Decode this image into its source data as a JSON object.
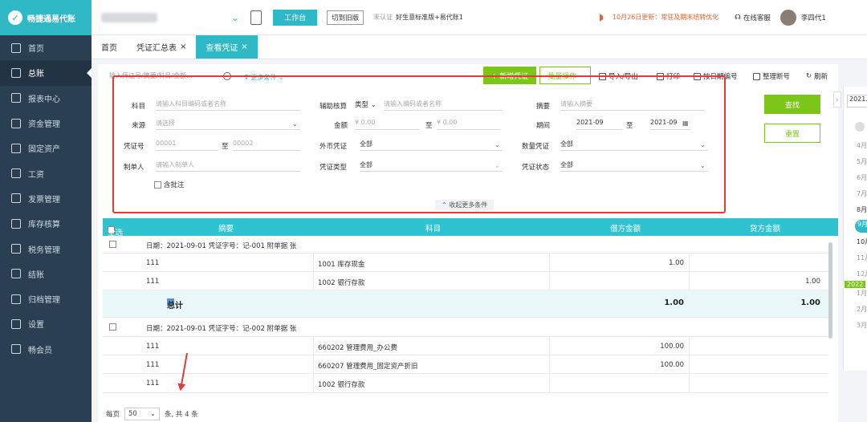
{
  "app": {
    "name": "畅捷通易代账",
    "plan": "好生意标准版+易代账1",
    "cert": "未认证"
  },
  "topbar": {
    "workbench": "工作台",
    "old_version": "切到旧版",
    "notice": "10月26日更新：常驻及期末结转优化",
    "service": "在线客服",
    "user": "李四代1"
  },
  "sidebar": {
    "items": [
      {
        "label": "首页"
      },
      {
        "label": "总账"
      },
      {
        "label": "报表中心"
      },
      {
        "label": "资金管理"
      },
      {
        "label": "固定资产"
      },
      {
        "label": "工资"
      },
      {
        "label": "发票管理"
      },
      {
        "label": "库存核算"
      },
      {
        "label": "税务管理"
      },
      {
        "label": "结账"
      },
      {
        "label": "归档管理"
      },
      {
        "label": "设置"
      },
      {
        "label": "畅会员"
      }
    ]
  },
  "tabs": [
    {
      "label": "首页"
    },
    {
      "label": "凭证汇总表"
    },
    {
      "label": "查看凭证"
    }
  ],
  "toolbar": {
    "search_placeholder": "输入凭证号/摘要/科目/金额...",
    "more_conditions": "更多条件",
    "new_voucher": "+ 新增凭证",
    "batch": "批量操作",
    "import_export": "导入/导出",
    "print": "打印",
    "renumber": "按日期编号",
    "reorder": "整理断号",
    "refresh": "刷新"
  },
  "filter": {
    "subject_label": "科目",
    "subject_ph": "请输入科目编码或者名称",
    "aux_label": "辅助核算",
    "aux_type": "类型",
    "aux_ph": "请输入编码或者名称",
    "summary_label": "摘要",
    "summary_ph": "请输入摘要",
    "source_label": "来源",
    "source_ph": "请选择",
    "amount_label": "金额",
    "amount_from": "¥ 0.00",
    "amount_to_sep": "至",
    "amount_to": "¥ 0.00",
    "period_label": "期间",
    "period_from": "2021-09",
    "period_sep": "至",
    "period_to": "2021-09",
    "voucher_no_label": "凭证号",
    "voucher_no_from": "00001",
    "voucher_no_sep": "至",
    "voucher_no_to": "00002",
    "foreign_label": "外币凭证",
    "foreign_val": "全部",
    "qty_label": "数量凭证",
    "qty_val": "全部",
    "maker_label": "制单人",
    "maker_ph": "请输入制单人",
    "vtype_label": "凭证类型",
    "vtype_val": "全部",
    "vstatus_label": "凭证状态",
    "vstatus_val": "全部",
    "include_annot": "含批注",
    "collapse": "收起更多条件",
    "query": "查找",
    "reset": "重置"
  },
  "table": {
    "headers": {
      "select_all": "全选",
      "summary": "摘要",
      "subject": "科目",
      "debit": "借方金额",
      "credit": "贷方金额"
    },
    "vouchers": [
      {
        "header": "日期：2021-09-01    凭证字号：记-001    附单据  张",
        "lines": [
          {
            "summary": "111",
            "subject": "1001 库存现金",
            "debit": "1.00",
            "credit": ""
          },
          {
            "summary": "111",
            "subject": "1002 银行存款",
            "debit": "",
            "credit": "1.00"
          }
        ],
        "total_label": "总计",
        "total_debit": "1.00",
        "total_credit": "1.00"
      },
      {
        "header": "日期：2021-09-01    凭证字号：记-002    附单据  张",
        "lines": [
          {
            "summary": "111",
            "subject": "660202 管理费用_办公费",
            "debit": "100.00",
            "credit": ""
          },
          {
            "summary": "111",
            "subject": "660207 管理费用_固定资产折旧",
            "debit": "100.00",
            "credit": ""
          },
          {
            "summary": "111",
            "subject": "1002 银行存款",
            "debit": "",
            "credit": ""
          }
        ]
      }
    ]
  },
  "pager": {
    "per_page_label": "每页",
    "per_page": "50",
    "summary": "条, 共 4 条"
  },
  "calendar": {
    "input": "2021.0",
    "months": [
      "4月",
      "5月",
      "6月",
      "7月",
      "8月",
      "9月",
      "10月",
      "11月",
      "12月",
      "1月",
      "2月",
      "3月"
    ],
    "year_badge": "2022"
  },
  "colors": {
    "accent": "#2fb9c7",
    "green": "#7cc61a",
    "highlight": "#e03a3a",
    "sidebar": "#2b3f52"
  }
}
